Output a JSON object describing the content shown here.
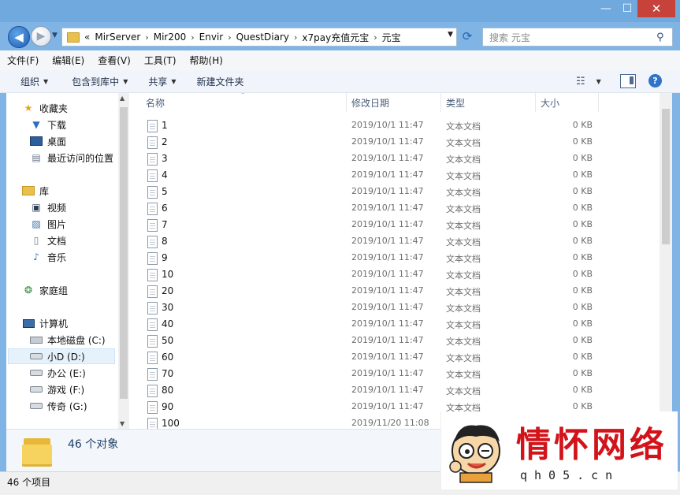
{
  "window": {
    "minimize": "—",
    "maximize": "☐",
    "close": "✕"
  },
  "nav": {
    "back": "◀",
    "forward": "▶"
  },
  "address": {
    "overflow": "«",
    "crumbs": [
      "MirServer",
      "Mir200",
      "Envir",
      "QuestDiary",
      "x7pay充值元宝",
      "元宝"
    ]
  },
  "search": {
    "placeholder": "搜索 元宝"
  },
  "menu": [
    "文件(F)",
    "编辑(E)",
    "查看(V)",
    "工具(T)",
    "帮助(H)"
  ],
  "commands": {
    "organize": "组织",
    "include_library": "包含到库中",
    "share": "共享",
    "new_folder": "新建文件夹"
  },
  "sidebar": {
    "favorites": "收藏夹",
    "downloads": "下载",
    "desktop": "桌面",
    "recent": "最近访问的位置",
    "libraries": "库",
    "videos": "视频",
    "pictures": "图片",
    "documents": "文档",
    "music": "音乐",
    "homegroup": "家庭组",
    "computer": "计算机",
    "drive_c": "本地磁盘 (C:)",
    "drive_d": "小D (D:)",
    "drive_e": "办公 (E:)",
    "drive_f": "游戏 (F:)",
    "drive_g": "传奇 (G:)"
  },
  "columns": {
    "name": "名称",
    "date": "修改日期",
    "type": "类型",
    "size": "大小"
  },
  "files": [
    {
      "name": "1",
      "date": "2019/10/1 11:47",
      "type": "文本文档",
      "size": "0 KB"
    },
    {
      "name": "2",
      "date": "2019/10/1 11:47",
      "type": "文本文档",
      "size": "0 KB"
    },
    {
      "name": "3",
      "date": "2019/10/1 11:47",
      "type": "文本文档",
      "size": "0 KB"
    },
    {
      "name": "4",
      "date": "2019/10/1 11:47",
      "type": "文本文档",
      "size": "0 KB"
    },
    {
      "name": "5",
      "date": "2019/10/1 11:47",
      "type": "文本文档",
      "size": "0 KB"
    },
    {
      "name": "6",
      "date": "2019/10/1 11:47",
      "type": "文本文档",
      "size": "0 KB"
    },
    {
      "name": "7",
      "date": "2019/10/1 11:47",
      "type": "文本文档",
      "size": "0 KB"
    },
    {
      "name": "8",
      "date": "2019/10/1 11:47",
      "type": "文本文档",
      "size": "0 KB"
    },
    {
      "name": "9",
      "date": "2019/10/1 11:47",
      "type": "文本文档",
      "size": "0 KB"
    },
    {
      "name": "10",
      "date": "2019/10/1 11:47",
      "type": "文本文档",
      "size": "0 KB"
    },
    {
      "name": "20",
      "date": "2019/10/1 11:47",
      "type": "文本文档",
      "size": "0 KB"
    },
    {
      "name": "30",
      "date": "2019/10/1 11:47",
      "type": "文本文档",
      "size": "0 KB"
    },
    {
      "name": "40",
      "date": "2019/10/1 11:47",
      "type": "文本文档",
      "size": "0 KB"
    },
    {
      "name": "50",
      "date": "2019/10/1 11:47",
      "type": "文本文档",
      "size": "0 KB"
    },
    {
      "name": "60",
      "date": "2019/10/1 11:47",
      "type": "文本文档",
      "size": "0 KB"
    },
    {
      "name": "70",
      "date": "2019/10/1 11:47",
      "type": "文本文档",
      "size": "0 KB"
    },
    {
      "name": "80",
      "date": "2019/10/1 11:47",
      "type": "文本文档",
      "size": "0 KB"
    },
    {
      "name": "90",
      "date": "2019/10/1 11:47",
      "type": "文本文档",
      "size": "0 KB"
    },
    {
      "name": "100",
      "date": "2019/11/20 11:08",
      "type": "",
      "size": ""
    }
  ],
  "details": {
    "count": "46 个对象"
  },
  "status": {
    "count": "46 个项目"
  },
  "watermark": {
    "text": "情怀网络",
    "url": "qh05.cn"
  },
  "colors": {
    "accent": "#2e74c8",
    "titlebar": "#6fa9de",
    "close": "#c7423b",
    "watermark": "#d2131a"
  }
}
